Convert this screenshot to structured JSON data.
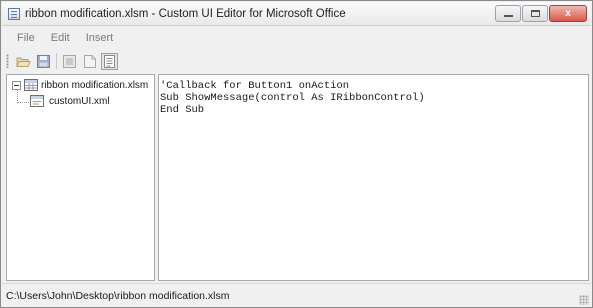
{
  "window": {
    "title": "ribbon modification.xlsm - Custom UI Editor for Microsoft Office",
    "close_glyph": "x"
  },
  "menu": {
    "items": [
      "File",
      "Edit",
      "Insert"
    ]
  },
  "toolbar": {
    "buttons": [
      {
        "icon": "open-folder-icon"
      },
      {
        "icon": "save-icon"
      },
      {
        "icon": "insert-icons-icon"
      },
      {
        "icon": "validate-icon"
      },
      {
        "icon": "generate-callbacks-icon",
        "selected": true
      }
    ]
  },
  "tree": {
    "root": {
      "label": "ribbon modification.xlsm",
      "icon": "workbook-icon",
      "expanded": true
    },
    "children": [
      {
        "label": "customUI.xml",
        "icon": "xml-file-icon"
      }
    ]
  },
  "editor": {
    "lines": [
      "'Callback for Button1 onAction",
      "Sub ShowMessage(control As IRibbonControl)",
      "End Sub"
    ]
  },
  "status": {
    "path": "C:\\Users\\John\\Desktop\\ribbon modification.xlsm"
  },
  "colors": {
    "window_bg": "#f0f0f0",
    "close_button": "#d9574a",
    "text": "#1a1a1a",
    "menu_text_disabled": "#7a7a7a"
  }
}
